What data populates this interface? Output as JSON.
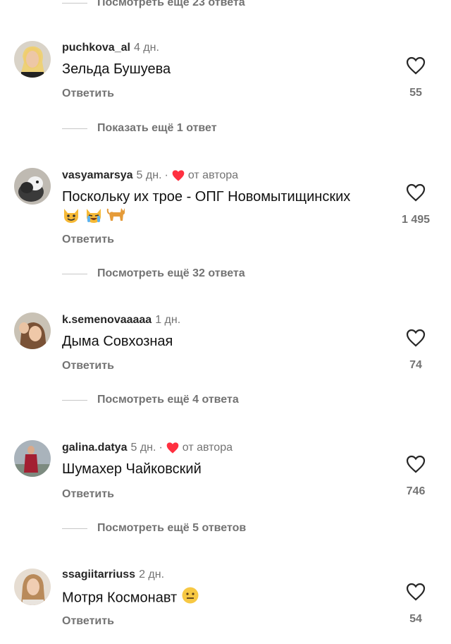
{
  "top_replies": "Посмотреть ещё 23 ответа",
  "reply_label": "Ответить",
  "by_author": "от автора",
  "dot": "·",
  "comments": [
    {
      "user": "puchkova_al",
      "time": "4 дн.",
      "text": "Зельда Бушуева",
      "likes": "55",
      "more": "Показать ещё 1 ответ"
    },
    {
      "user": "vasyamarsya",
      "time": "5 дн.",
      "text": "Поскольку их трое - ОПГ Новомытищинских",
      "likes": "1 495",
      "more": "Посмотреть ещё 32 ответа",
      "emojis": [
        "cat-face-icon",
        "crying-cat-icon",
        "cat-icon"
      ]
    },
    {
      "user": "k.semenovaaaaa",
      "time": "1 дн.",
      "text": "Дыма Совхозная",
      "likes": "74",
      "more": "Посмотреть ещё 4 ответа"
    },
    {
      "user": "galina.datya",
      "time": "5 дн.",
      "text": "Шумахер Чайковский",
      "likes": "746",
      "more": "Посмотреть ещё 5 ответов"
    },
    {
      "user": "ssagiitarriuss",
      "time": "2 дн.",
      "text": "Мотря Космонавт",
      "likes": "54",
      "emoji": "neutral-face-icon"
    }
  ],
  "colors": {
    "secondary": "#737373",
    "heart_red": "#ff3040",
    "divider": "#c7c7c7"
  }
}
